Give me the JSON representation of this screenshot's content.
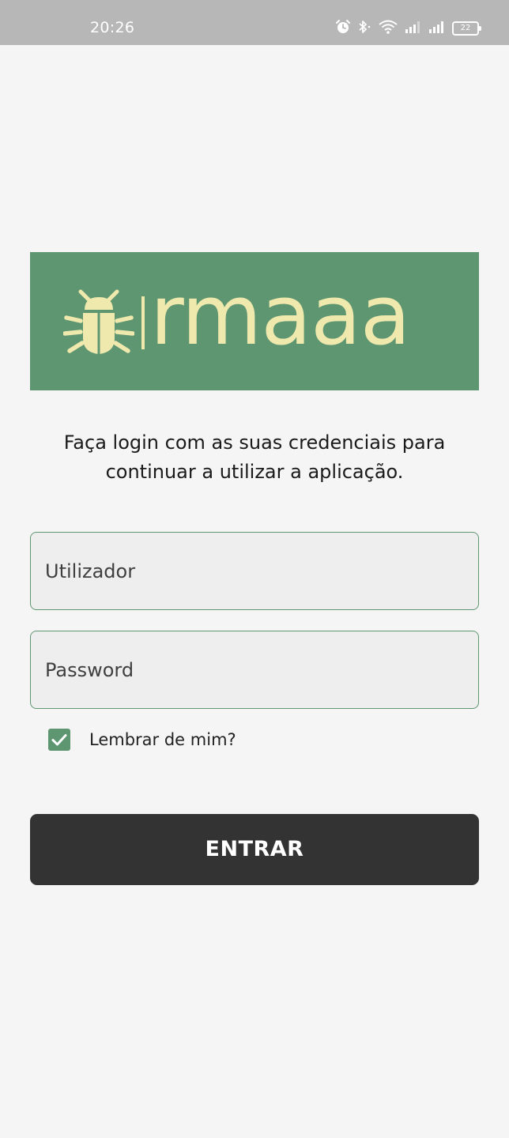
{
  "status_bar": {
    "time": "20:26",
    "icons": [
      "alarm-icon",
      "bluetooth-icon",
      "wifi-icon",
      "signal-icon",
      "signal-icon",
      "battery-icon"
    ],
    "battery_level": "22"
  },
  "logo": {
    "text": "rmaaa",
    "icon": "bug-icon",
    "banner_color": "#5f9672",
    "text_color": "#f0e9ad"
  },
  "intro_text": "Faça login com as suas credenciais para continuar a utilizar a aplicação.",
  "form": {
    "username_placeholder": "Utilizador",
    "password_placeholder": "Password",
    "remember_label": "Lembrar de mim?",
    "remember_checked": true,
    "submit_label": "ENTRAR"
  },
  "colors": {
    "accent": "#5f9672",
    "button": "#333333",
    "background": "#f5f5f5"
  }
}
